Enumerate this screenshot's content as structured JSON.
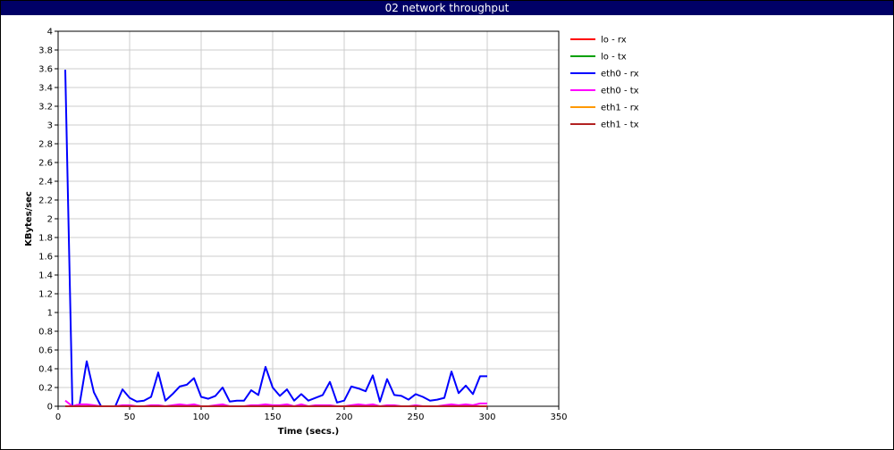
{
  "chart_data": {
    "type": "line",
    "title": "02 network throughput",
    "xlabel": "Time (secs.)",
    "ylabel": "KBytes/sec",
    "xlim": [
      0,
      350
    ],
    "ylim": [
      0,
      4
    ],
    "x_ticks": [
      "0",
      "50",
      "100",
      "150",
      "200",
      "250",
      "300",
      "350"
    ],
    "y_ticks": [
      "0",
      "0.2",
      "0.4",
      "0.6",
      "0.8",
      "1",
      "1.2",
      "1.4",
      "1.6",
      "1.8",
      "2",
      "2.2",
      "2.4",
      "2.6",
      "2.8",
      "3",
      "3.2",
      "3.4",
      "3.6",
      "3.8",
      "4"
    ],
    "grid": true,
    "legend_position": "right",
    "series": [
      {
        "name": "lo - rx",
        "color": "#ff0000",
        "x": [
          5,
          300
        ],
        "values": [
          0,
          0
        ]
      },
      {
        "name": "lo - tx",
        "color": "#00a000",
        "x": [
          5,
          300
        ],
        "values": [
          0,
          0
        ]
      },
      {
        "name": "eth0 - rx",
        "color": "#0000ff",
        "x": [
          5,
          10,
          15,
          20,
          25,
          30,
          35,
          40,
          45,
          50,
          55,
          60,
          65,
          70,
          75,
          80,
          85,
          90,
          95,
          100,
          105,
          110,
          115,
          120,
          125,
          130,
          135,
          140,
          145,
          150,
          155,
          160,
          165,
          170,
          175,
          180,
          185,
          190,
          195,
          200,
          205,
          210,
          215,
          220,
          225,
          230,
          235,
          240,
          245,
          250,
          255,
          260,
          265,
          270,
          275,
          280,
          285,
          290,
          295,
          300
        ],
        "values": [
          3.59,
          0.0,
          0.02,
          0.48,
          0.15,
          0.0,
          0.0,
          0.0,
          0.18,
          0.09,
          0.05,
          0.06,
          0.1,
          0.36,
          0.06,
          0.13,
          0.21,
          0.23,
          0.3,
          0.1,
          0.08,
          0.11,
          0.2,
          0.05,
          0.06,
          0.06,
          0.17,
          0.12,
          0.42,
          0.2,
          0.11,
          0.18,
          0.06,
          0.13,
          0.06,
          0.09,
          0.12,
          0.26,
          0.04,
          0.06,
          0.21,
          0.19,
          0.16,
          0.33,
          0.05,
          0.29,
          0.12,
          0.11,
          0.07,
          0.13,
          0.1,
          0.06,
          0.07,
          0.09,
          0.37,
          0.14,
          0.22,
          0.13,
          0.32,
          0.32
        ]
      },
      {
        "name": "eth0 - tx",
        "color": "#ff00ff",
        "x": [
          5,
          10,
          15,
          20,
          25,
          30,
          35,
          40,
          45,
          50,
          55,
          60,
          65,
          70,
          75,
          80,
          85,
          90,
          95,
          100,
          105,
          110,
          115,
          120,
          125,
          130,
          135,
          140,
          145,
          150,
          155,
          160,
          165,
          170,
          175,
          180,
          185,
          190,
          195,
          200,
          205,
          210,
          215,
          220,
          225,
          230,
          235,
          240,
          245,
          250,
          255,
          260,
          265,
          270,
          275,
          280,
          285,
          290,
          295,
          300
        ],
        "values": [
          0.06,
          0.0,
          0.02,
          0.02,
          0.01,
          0.0,
          0.0,
          0.0,
          0.01,
          0.01,
          0.0,
          0.0,
          0.01,
          0.01,
          0.0,
          0.01,
          0.02,
          0.01,
          0.02,
          0.0,
          0.0,
          0.01,
          0.02,
          0.0,
          0.0,
          0.0,
          0.01,
          0.01,
          0.02,
          0.01,
          0.01,
          0.02,
          0.0,
          0.02,
          0.0,
          0.01,
          0.01,
          0.01,
          0.0,
          0.0,
          0.01,
          0.02,
          0.01,
          0.02,
          0.0,
          0.01,
          0.01,
          0.0,
          0.0,
          0.01,
          0.0,
          0.0,
          0.0,
          0.01,
          0.02,
          0.01,
          0.02,
          0.01,
          0.03,
          0.03
        ]
      },
      {
        "name": "eth1 - rx",
        "color": "#ff9900",
        "x": [
          5,
          300
        ],
        "values": [
          0,
          0
        ]
      },
      {
        "name": "eth1 - tx",
        "color": "#b22222",
        "x": [
          5,
          300
        ],
        "values": [
          0,
          0
        ]
      }
    ]
  }
}
